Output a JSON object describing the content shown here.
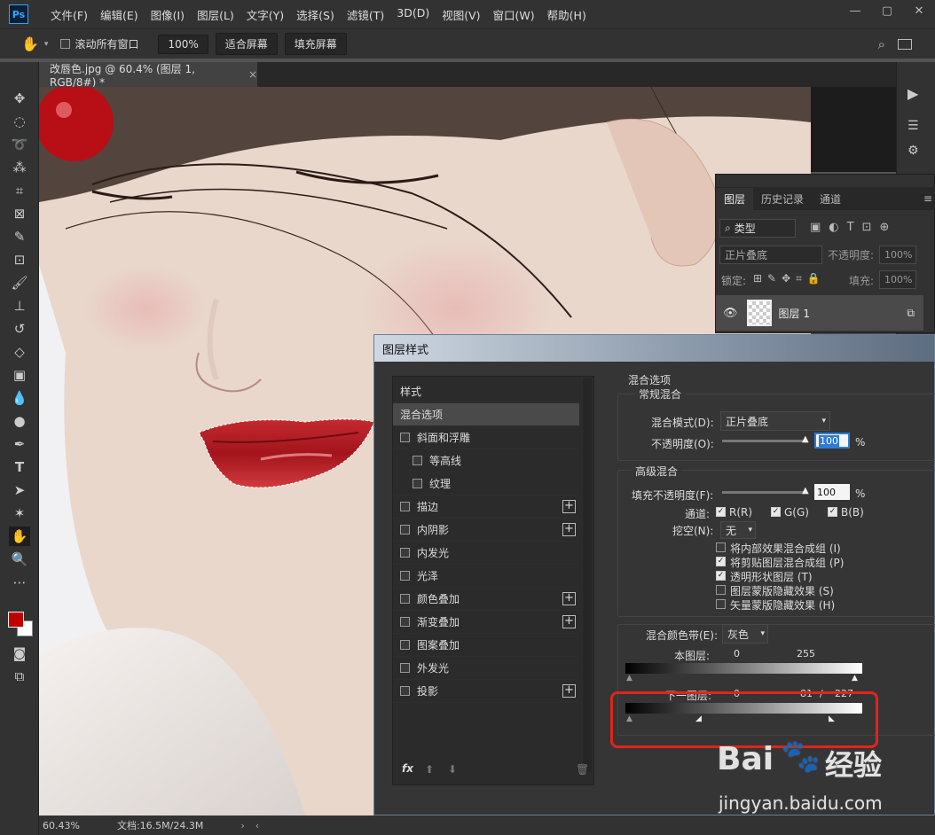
{
  "app": {
    "logo": "Ps"
  },
  "menubar": [
    "文件(F)",
    "编辑(E)",
    "图像(I)",
    "图层(L)",
    "文字(Y)",
    "选择(S)",
    "滤镜(T)",
    "3D(D)",
    "视图(V)",
    "窗口(W)",
    "帮助(H)"
  ],
  "window_controls": [
    "—",
    "▢",
    "✕"
  ],
  "options": {
    "scroll_all": "滚动所有窗口",
    "zoom": "100%",
    "fit_screen": "适合屏幕",
    "fill_screen": "填充屏幕"
  },
  "document": {
    "tab_title": "改唇色.jpg @ 60.4% (图层 1, RGB/8#) *",
    "close": "×"
  },
  "status": {
    "zoom": "60.43%",
    "doc": "文档:16.5M/24.3M"
  },
  "layers_panel": {
    "tabs": [
      "图层",
      "历史记录",
      "通道"
    ],
    "filter": "类型",
    "blend_mode": "正片叠底",
    "opacity_label": "不透明度:",
    "opacity": "100%",
    "lock_label": "锁定:",
    "fill_label": "填充:",
    "fill": "100%",
    "layer_name": "图层 1"
  },
  "dialog": {
    "title": "图层样式",
    "styles": [
      {
        "label": "样式",
        "checkbox": false,
        "plus": false,
        "indent": false,
        "active": false
      },
      {
        "label": "混合选项",
        "checkbox": false,
        "plus": false,
        "indent": false,
        "active": true
      },
      {
        "label": "斜面和浮雕",
        "checkbox": true,
        "plus": false,
        "indent": false,
        "active": false
      },
      {
        "label": "等高线",
        "checkbox": true,
        "plus": false,
        "indent": true,
        "active": false
      },
      {
        "label": "纹理",
        "checkbox": true,
        "plus": false,
        "indent": true,
        "active": false
      },
      {
        "label": "描边",
        "checkbox": true,
        "plus": true,
        "indent": false,
        "active": false
      },
      {
        "label": "内阴影",
        "checkbox": true,
        "plus": true,
        "indent": false,
        "active": false
      },
      {
        "label": "内发光",
        "checkbox": true,
        "plus": false,
        "indent": false,
        "active": false
      },
      {
        "label": "光泽",
        "checkbox": true,
        "plus": false,
        "indent": false,
        "active": false
      },
      {
        "label": "颜色叠加",
        "checkbox": true,
        "plus": true,
        "indent": false,
        "active": false
      },
      {
        "label": "渐变叠加",
        "checkbox": true,
        "plus": true,
        "indent": false,
        "active": false
      },
      {
        "label": "图案叠加",
        "checkbox": true,
        "plus": false,
        "indent": false,
        "active": false
      },
      {
        "label": "外发光",
        "checkbox": true,
        "plus": false,
        "indent": false,
        "active": false
      },
      {
        "label": "投影",
        "checkbox": true,
        "plus": true,
        "indent": false,
        "active": false
      }
    ],
    "fx": "fx",
    "blend_options": "混合选项",
    "general_blend": "常规混合",
    "blend_mode_label": "混合模式(D):",
    "blend_mode": "正片叠底",
    "opacity_label": "不透明度(O):",
    "opacity": "100",
    "pct": "%",
    "advanced_blend": "高级混合",
    "fill_opacity_label": "填充不透明度(F):",
    "fill_opacity": "100",
    "channels_label": "通道:",
    "channels": [
      "R(R)",
      "G(G)",
      "B(B)"
    ],
    "knockout_label": "挖空(N):",
    "knockout": "无",
    "options": [
      {
        "label": "将内部效果混合成组 (I)",
        "checked": false
      },
      {
        "label": "将剪贴图层混合成组 (P)",
        "checked": true
      },
      {
        "label": "透明形状图层 (T)",
        "checked": true
      },
      {
        "label": "图层蒙版隐藏效果 (S)",
        "checked": false
      },
      {
        "label": "矢量蒙版隐藏效果 (H)",
        "checked": false
      }
    ],
    "blend_if_label": "混合颜色带(E):",
    "blend_if": "灰色",
    "this_layer_label": "本图层:",
    "this_layer_min": "0",
    "this_layer_max": "255",
    "underlying_label": "下一图层:",
    "underlying_min": "0",
    "underlying_mid": "81",
    "underlying_sep": "/",
    "underlying_max": "227"
  },
  "watermark": {
    "brand": "Bai",
    "brand2": "经验",
    "url": "jingyan.baidu.com"
  }
}
